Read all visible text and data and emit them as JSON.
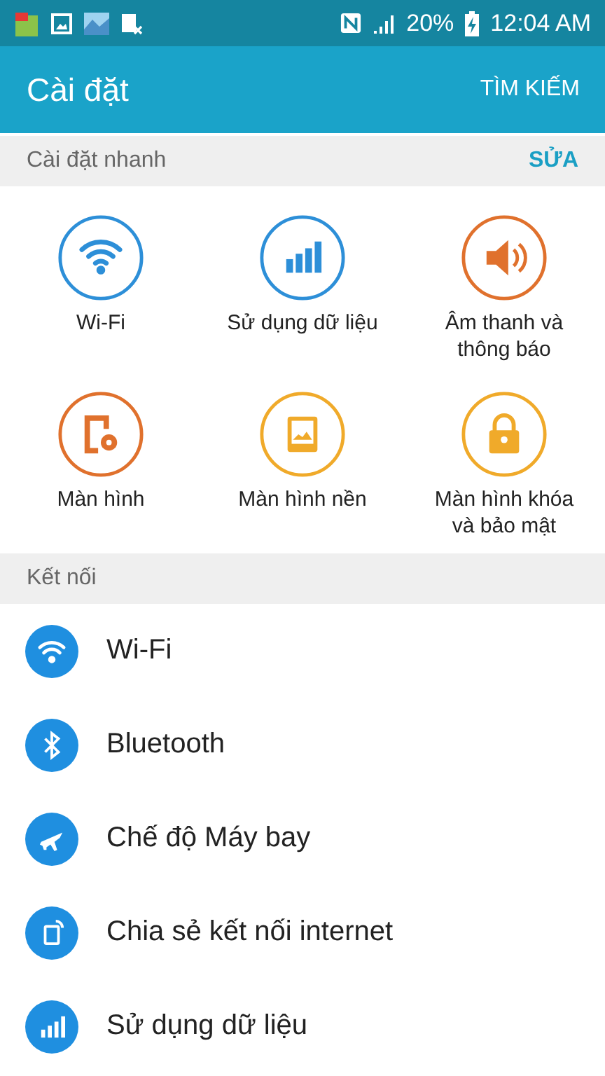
{
  "status_bar": {
    "battery": "20%",
    "time": "12:04 AM"
  },
  "app_bar": {
    "title": "Cài đặt",
    "action": "TÌM KIẾM"
  },
  "quick_settings": {
    "header": "Cài đặt nhanh",
    "edit": "SỬA",
    "tiles": [
      {
        "label": "Wi-Fi",
        "kind": "wifi",
        "color": "#2d8fd8"
      },
      {
        "label": "Sử dụng dữ liệu",
        "kind": "data",
        "color": "#2d8fd8"
      },
      {
        "label": "Âm thanh và thông báo",
        "kind": "sound",
        "color": "#e0712d"
      },
      {
        "label": "Màn hình",
        "kind": "display",
        "color": "#e0712d"
      },
      {
        "label": "Màn hình nền",
        "kind": "wallpaper",
        "color": "#f0aa2a"
      },
      {
        "label": "Màn hình khóa và bảo mật",
        "kind": "lock",
        "color": "#f0aa2a"
      }
    ]
  },
  "connections": {
    "header": "Kết nối",
    "items": [
      {
        "label": "Wi-Fi",
        "kind": "wifi"
      },
      {
        "label": "Bluetooth",
        "kind": "bluetooth"
      },
      {
        "label": "Chế độ Máy bay",
        "kind": "plane"
      },
      {
        "label": "Chia sẻ kết nối internet",
        "kind": "tether"
      },
      {
        "label": "Sử dụng dữ liệu",
        "kind": "data"
      }
    ]
  }
}
